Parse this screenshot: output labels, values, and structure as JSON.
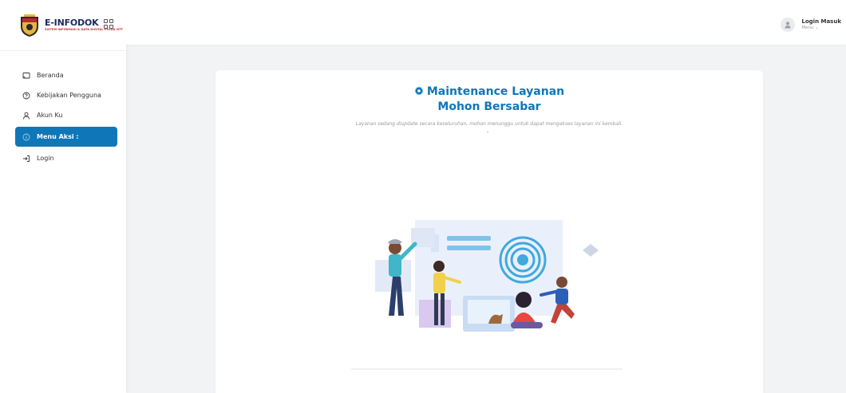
{
  "brand": {
    "title": "E-INFODOK",
    "subtitle": "SISTEM INFORMASI & DATA DIGITAL POLDA NTT"
  },
  "sidebar": {
    "items": [
      {
        "label": "Beranda",
        "icon": "cast-icon",
        "active": false
      },
      {
        "label": "Kebijakan Pengguna",
        "icon": "help-circle-icon",
        "active": false
      },
      {
        "label": "Akun Ku",
        "icon": "user-icon",
        "active": false
      },
      {
        "label": "Menu Aksi :",
        "icon": "info-circle-icon",
        "active": true
      },
      {
        "label": "Login",
        "icon": "login-icon",
        "active": false
      }
    ]
  },
  "header": {
    "user_name": "Login Masuk",
    "user_menu": "Menu ⌄"
  },
  "main": {
    "title": "Maintenance Layanan",
    "subtitle": "Mohon Bersabar",
    "description": "Layanan sedang diupdate secara keseluruhan, mohon menunggu untuk dapat mengakses layanan ini kembali."
  },
  "colors": {
    "accent": "#0f77b8",
    "background": "#f2f3f5"
  }
}
